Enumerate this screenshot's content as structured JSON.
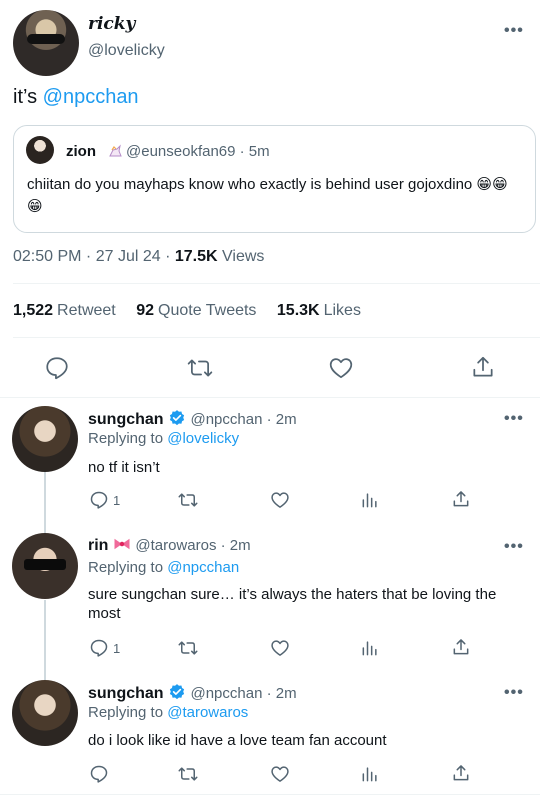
{
  "main": {
    "name": "ricky",
    "handle": "@lovelicky",
    "more": "•••",
    "text_prefix": "it’s ",
    "text_mention": "@npcchan",
    "quote": {
      "name": "zion",
      "meta": "@eunseokfan69 · 5m",
      "text": "chiitan do you mayhaps know who exactly is behind user gojoxdino 😁😁😁"
    },
    "timestamp": "02:50 PM · 27 Jul 24 · ",
    "views_count": "17.5K",
    "views_label": " Views",
    "stats": {
      "retweets_count": "1,522",
      "retweets_label": "Retweet",
      "quotes_count": "92",
      "quotes_label": "Quote Tweets",
      "likes_count": "15.3K",
      "likes_label": "Likes"
    }
  },
  "replies": [
    {
      "name": "sungchan",
      "meta": "@npcchan · 2m",
      "replying_label": "Replying to ",
      "replying_to": "@lovelicky",
      "text": "no tf it isn’t",
      "reply_count": "1"
    },
    {
      "name": "rin",
      "meta": "@tarowaros · 2m",
      "replying_label": "Replying to ",
      "replying_to": "@npcchan",
      "text": "sure sungchan sure… it’s always the haters that be loving the most",
      "reply_count": "1"
    },
    {
      "name": "sungchan",
      "meta": "@npcchan · 2m",
      "replying_label": "Replying to ",
      "replying_to": "@tarowaros",
      "text": "do i look like id have a love team fan account",
      "reply_count": ""
    }
  ],
  "colors": {
    "accent": "#1d9bf0",
    "secondary_text": "#536471",
    "divider": "#eff3f4",
    "rin_emoji": "#e0245e"
  }
}
